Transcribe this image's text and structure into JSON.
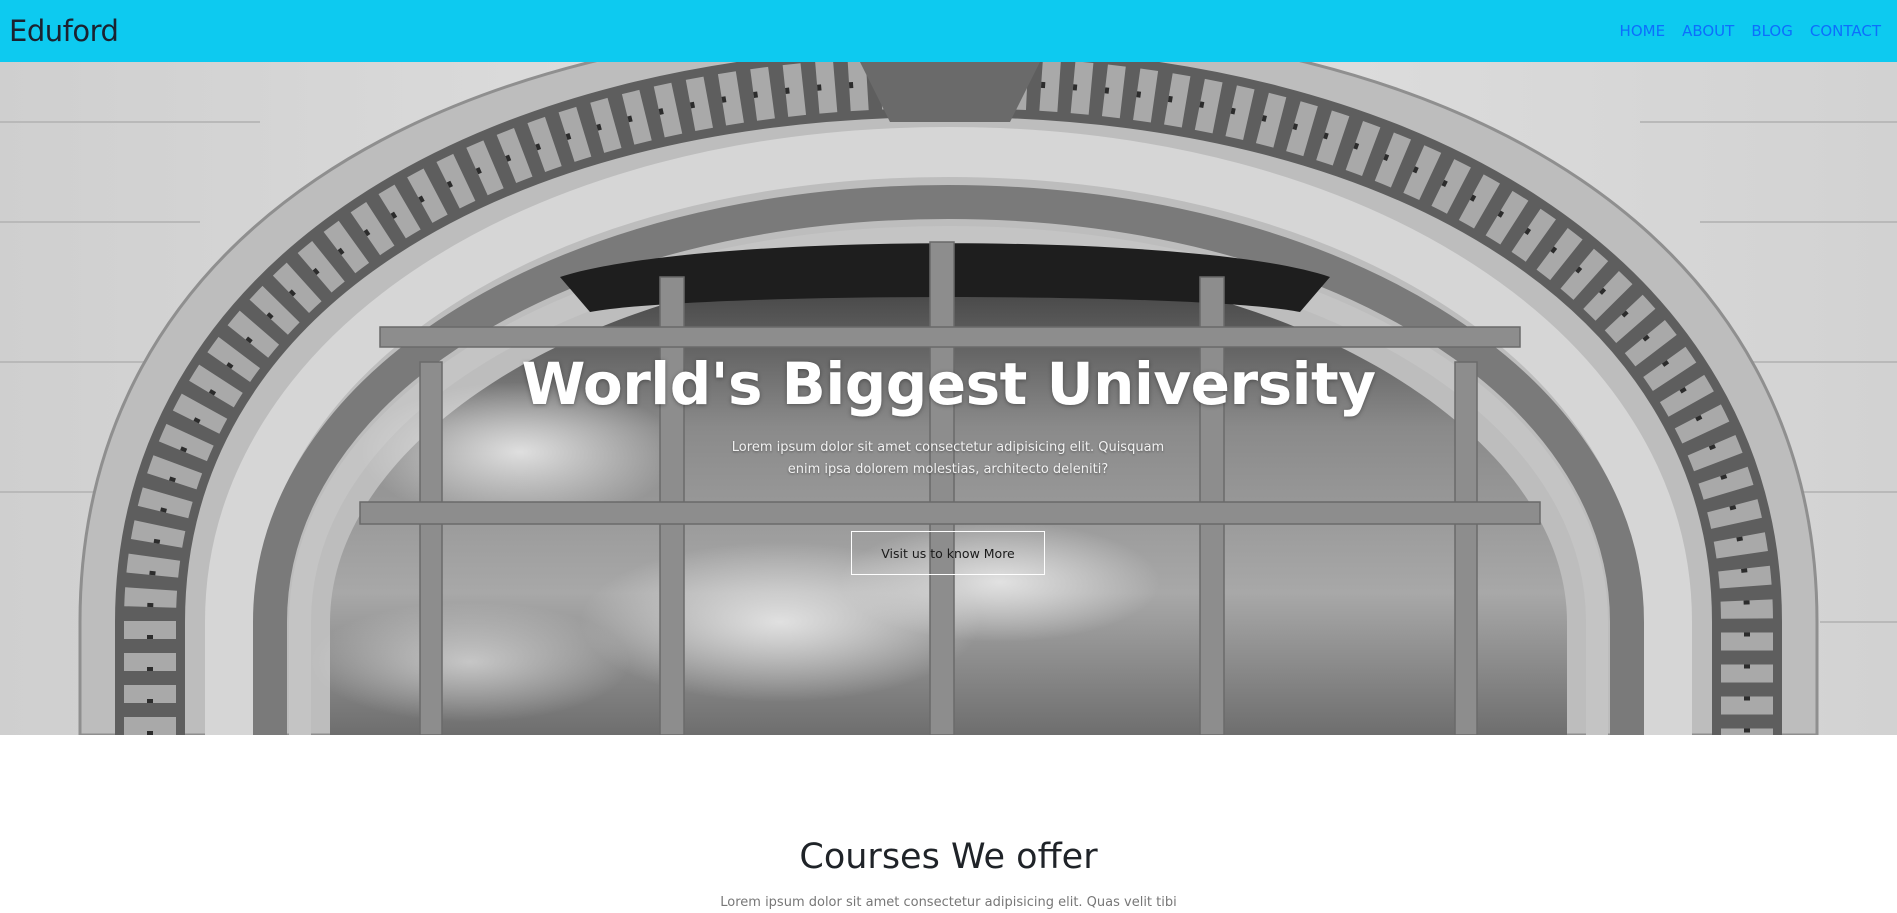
{
  "navbar": {
    "brand": "Eduford",
    "links": [
      {
        "label": "HOME"
      },
      {
        "label": "ABOUT"
      },
      {
        "label": "BLOG"
      },
      {
        "label": "CONTACT"
      }
    ],
    "background_color": "#0dcaf0",
    "link_color": "#0d6efd"
  },
  "hero": {
    "title": "World's Biggest University",
    "text": "Lorem ipsum dolor sit amet consectetur adipisicing elit. Quisquam enim ipsa dolorem molestias, architecto deleniti?",
    "button_label": "Visit us to know More",
    "background_image": "grayscale photo of an ornate stone arched window with cloudy sky reflections"
  },
  "courses": {
    "title": "Courses We offer",
    "subtitle": "Lorem ipsum dolor sit amet consectetur adipisicing elit. Quas velit tibi"
  }
}
